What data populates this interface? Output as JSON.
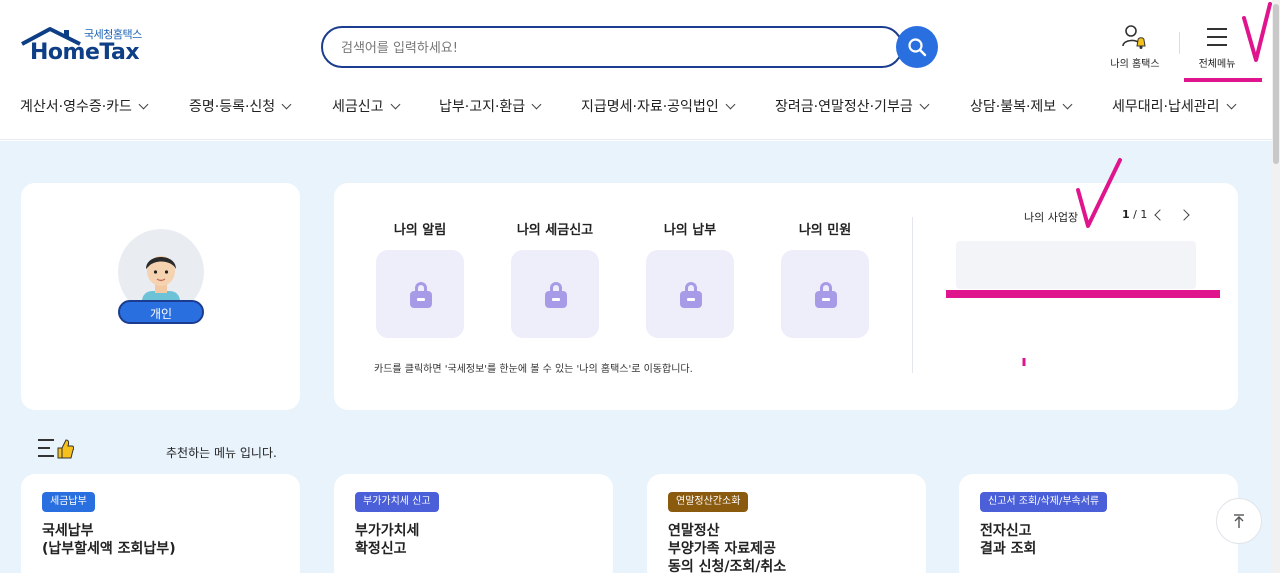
{
  "logo": {
    "kor": "국세청홈택스",
    "eng": "HomeTax"
  },
  "search": {
    "placeholder": "검색어를 입력하세요!"
  },
  "header": {
    "my_hometax": "나의 홈택스",
    "all_menu": "전체메뉴"
  },
  "gnb": [
    {
      "label": "계산서·영수증·카드"
    },
    {
      "label": "증명·등록·신청"
    },
    {
      "label": "세금신고"
    },
    {
      "label": "납부·고지·환급"
    },
    {
      "label": "지급명세·자료·공익법인"
    },
    {
      "label": "장려금·연말정산·기부금"
    },
    {
      "label": "상담·불복·제보"
    },
    {
      "label": "세무대리·납세관리"
    }
  ],
  "profile": {
    "type_label": "개인"
  },
  "my_services": [
    {
      "title": "나의 알림"
    },
    {
      "title": "나의 세금신고"
    },
    {
      "title": "나의 납부"
    },
    {
      "title": "나의 민원"
    }
  ],
  "my_services_note": "카드를 클릭하면 '국세정보'를 한눈에 볼 수 있는 '나의 홈택스'로 이동합니다.",
  "business": {
    "title": "나의 사업장",
    "page_current": "1",
    "page_sep": " / ",
    "page_total": "1"
  },
  "recommend_text": "추천하는 메뉴 입니다.",
  "recommend_cards": [
    {
      "tag": "세금납부",
      "tag_color": "#2a6fe0",
      "title": "국세납부\n(납부할세액 조회납부)"
    },
    {
      "tag": "부가가치세 신고",
      "tag_color": "#4a5fd8",
      "title": "부가가치세\n확정신고"
    },
    {
      "tag": "연말정산간소화",
      "tag_color": "#8a5a0e",
      "title": "연말정산\n부양가족 자료제공\n동의 신청/조회/취소"
    },
    {
      "tag": "신고서 조회/삭제/부속서류",
      "tag_color": "#4a5fd8",
      "title": "전자신고\n결과 조회"
    }
  ],
  "colors": {
    "brand": "#0e3f86",
    "accent": "#2a6fe0",
    "content_bg": "#e9f3fc",
    "annotation": "#e0148c"
  }
}
